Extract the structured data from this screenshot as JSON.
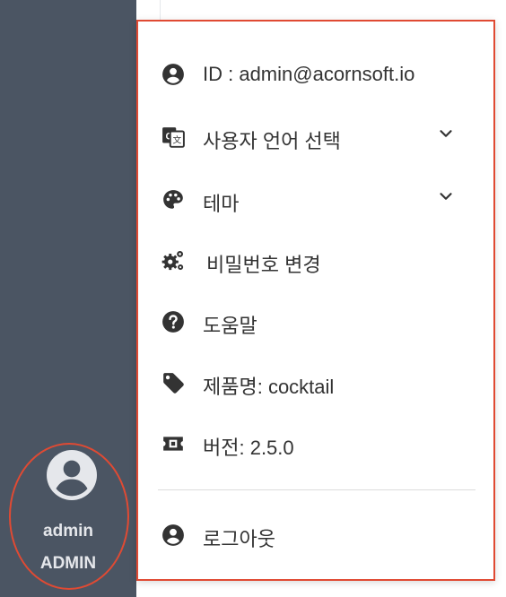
{
  "user": {
    "name": "admin",
    "role": "ADMIN"
  },
  "menu": {
    "id_label": "ID : admin@acornsoft.io",
    "language_label": "사용자 언어 선택",
    "theme_label": "테마",
    "password_label": "비밀번호 변경",
    "help_label": "도움말",
    "product_label": "제품명: cocktail",
    "version_label": "버전: 2.5.0",
    "logout_label": "로그아웃"
  },
  "colors": {
    "sidebar": "#4b5563",
    "highlight": "#e04a33",
    "icon": "#333333",
    "text": "#333333"
  }
}
